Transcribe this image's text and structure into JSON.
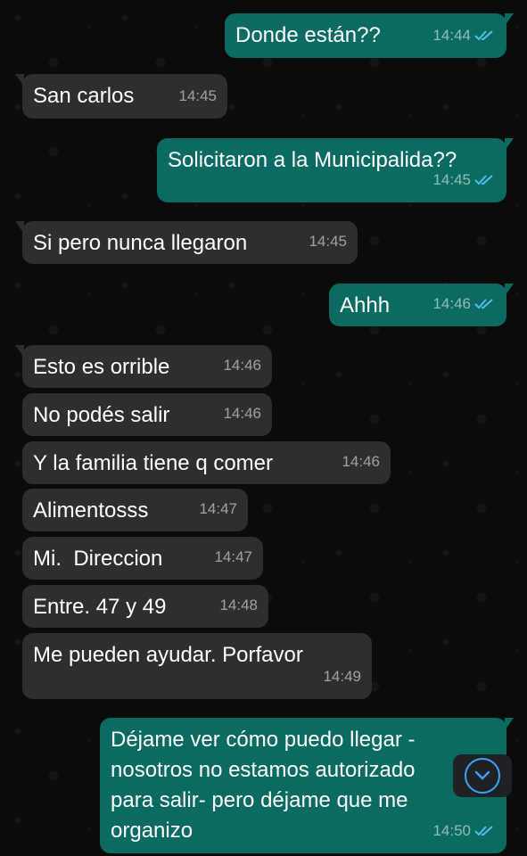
{
  "colors": {
    "background": "#0b0b0b",
    "incoming_bubble": "#2e2e2f",
    "outgoing_bubble": "#0b6a62",
    "read_tick": "#53bdeb",
    "scroll_button_accent": "#3aa3ff"
  },
  "messages": [
    {
      "direction": "outgoing",
      "text": "Donde están??",
      "time": "14:44",
      "status": "read"
    },
    {
      "direction": "incoming",
      "text": "San carlos",
      "time": "14:45"
    },
    {
      "direction": "outgoing",
      "text": "Solicitaron a la Municipalida??",
      "time": "14:45",
      "status": "read"
    },
    {
      "direction": "incoming",
      "text": "Si pero nunca llegaron",
      "time": "14:45"
    },
    {
      "direction": "outgoing",
      "text": "Ahhh",
      "time": "14:46",
      "status": "read"
    },
    {
      "direction": "incoming",
      "text": "Esto es orrible",
      "time": "14:46"
    },
    {
      "direction": "incoming",
      "text": "No podés salir",
      "time": "14:46"
    },
    {
      "direction": "incoming",
      "text": "Y la familia tiene q comer",
      "time": "14:46"
    },
    {
      "direction": "incoming",
      "text": "Alimentosss",
      "time": "14:47"
    },
    {
      "direction": "incoming",
      "text": "Mi.  Direccion",
      "time": "14:47"
    },
    {
      "direction": "incoming",
      "text": "Entre. 47 y 49",
      "time": "14:48"
    },
    {
      "direction": "incoming",
      "text": "Me pueden ayudar. Porfavor",
      "time": "14:49"
    },
    {
      "direction": "outgoing",
      "text": "Déjame ver cómo puedo llegar -\nnosotros no estamos autorizado\npara salir- pero déjame que me\norganizo",
      "time": "14:50",
      "status": "read"
    }
  ],
  "scroll_to_bottom": {
    "icon": "chevron-down-icon"
  }
}
